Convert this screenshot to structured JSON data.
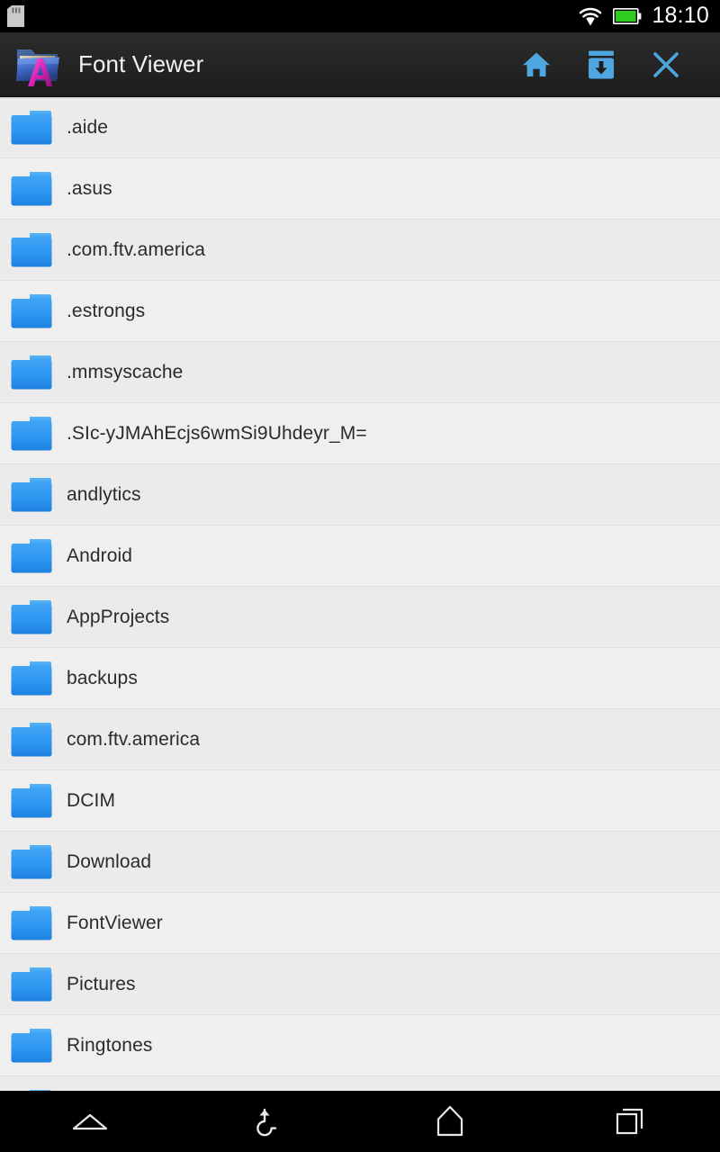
{
  "status_bar": {
    "sdcard_icon": "sdcard-icon",
    "wifi_icon": "wifi-icon",
    "battery_icon": "battery-full-icon",
    "time": "18:10"
  },
  "action_bar": {
    "app_icon": "font-viewer-folder-icon",
    "title": "Font Viewer",
    "actions": [
      {
        "name": "home-button",
        "icon": "home-icon"
      },
      {
        "name": "save-to-device-button",
        "icon": "download-box-icon"
      },
      {
        "name": "close-button",
        "icon": "close-x-icon"
      }
    ]
  },
  "file_list": {
    "items": [
      {
        "name": ".aide",
        "icon": "folder-icon",
        "type": "folder"
      },
      {
        "name": ".asus",
        "icon": "folder-icon",
        "type": "folder"
      },
      {
        "name": ".com.ftv.america",
        "icon": "folder-icon",
        "type": "folder"
      },
      {
        "name": ".estrongs",
        "icon": "folder-icon",
        "type": "folder"
      },
      {
        "name": ".mmsyscache",
        "icon": "folder-icon",
        "type": "folder"
      },
      {
        "name": ".SIc-yJMAhEcjs6wmSi9Uhdeyr_M=",
        "icon": "folder-icon",
        "type": "folder"
      },
      {
        "name": "andlytics",
        "icon": "folder-icon",
        "type": "folder"
      },
      {
        "name": "Android",
        "icon": "folder-icon",
        "type": "folder"
      },
      {
        "name": "AppProjects",
        "icon": "folder-icon",
        "type": "folder"
      },
      {
        "name": "backups",
        "icon": "folder-icon",
        "type": "folder"
      },
      {
        "name": "com.ftv.america",
        "icon": "folder-icon",
        "type": "folder"
      },
      {
        "name": "DCIM",
        "icon": "folder-icon",
        "type": "folder"
      },
      {
        "name": "Download",
        "icon": "folder-icon",
        "type": "folder"
      },
      {
        "name": "FontViewer",
        "icon": "folder-icon",
        "type": "folder"
      },
      {
        "name": "Pictures",
        "icon": "folder-icon",
        "type": "folder"
      },
      {
        "name": "Ringtones",
        "icon": "folder-icon",
        "type": "folder"
      },
      {
        "name": "",
        "icon": "folder-icon",
        "type": "folder"
      }
    ]
  },
  "nav_bar": {
    "buttons": [
      {
        "name": "nav-menu-expand-button",
        "icon": "chevron-up-outline-icon"
      },
      {
        "name": "nav-back-button",
        "icon": "back-arrow-icon"
      },
      {
        "name": "nav-home-button",
        "icon": "home-outline-icon"
      },
      {
        "name": "nav-recents-button",
        "icon": "recent-apps-icon"
      }
    ]
  },
  "colors": {
    "accent_blue": "#4da6e0",
    "folder_blue": "#2196f3",
    "status_bar_bg": "#000000",
    "action_bar_bg": "#242424",
    "list_bg": "#ebebeb",
    "battery_green": "#2ecc1e"
  }
}
